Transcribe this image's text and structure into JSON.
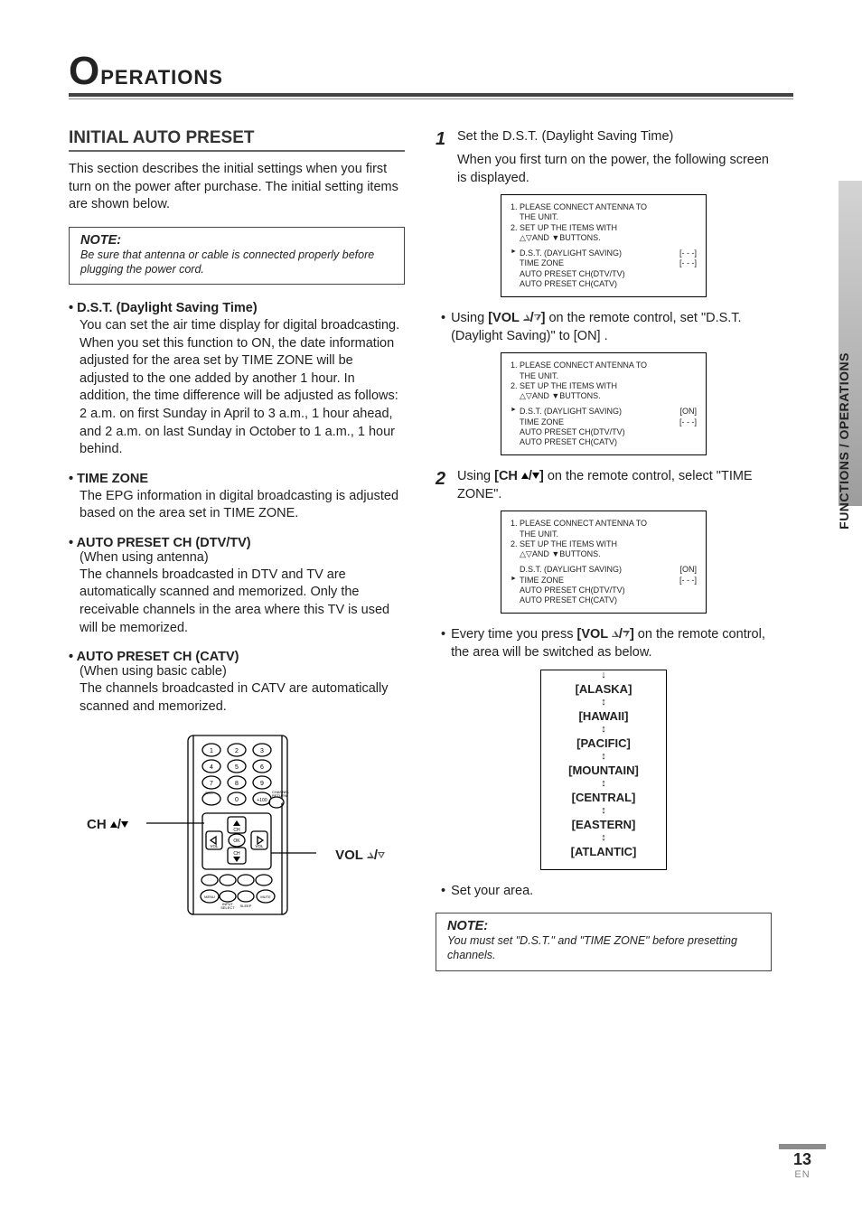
{
  "chapter": {
    "big_letter": "O",
    "rest": "PERATIONS"
  },
  "side_label": "FUNCTIONS / OPERATIONS",
  "page_number": "13",
  "page_lang": "EN",
  "left": {
    "section_title": "INITIAL AUTO PRESET",
    "intro": "This section describes the initial settings when you first turn on the power after purchase. The initial setting items are shown below.",
    "note1_title": "NOTE:",
    "note1_body": "Be sure that antenna or cable is connected properly before plugging the power cord.",
    "dst_head": "• D.S.T. (Daylight Saving Time)",
    "dst_body": "You can set the air time display for digital broadcasting. When you set this function to ON, the date information adjusted for the area set by TIME ZONE will be adjusted to the one added by another 1 hour. In addition, the time difference will be adjusted as follows: 2 a.m. on first Sunday in April to 3 a.m., 1 hour ahead, and 2 a.m. on last Sunday in October to 1 a.m., 1 hour behind.",
    "tz_head": "• TIME ZONE",
    "tz_body": "The EPG information in digital broadcasting is adjusted based on the area set in TIME ZONE.",
    "ap1_head": "• AUTO PRESET CH (DTV/TV)",
    "ap1_sub": "(When using antenna)",
    "ap1_body": "The channels broadcasted in DTV and TV are automatically scanned and memorized. Only the receivable channels in the area where this TV is used will be memorized.",
    "ap2_head": "• AUTO PRESET CH (CATV)",
    "ap2_sub": "(When using basic cable)",
    "ap2_body": "The channels broadcasted in CATV are automatically scanned and memorized.",
    "remote_left_label": "CH ▲/▼",
    "remote_right_label": "VOL △/▽"
  },
  "right": {
    "step1_num": "1",
    "step1_line1": "Set the D.S.T. (Daylight Saving Time)",
    "step1_line2": "When you first turn on the power, the following screen is displayed.",
    "osd_common": {
      "l1": "1. PLEASE CONNECT ANTENNA TO",
      "l1b": "THE UNIT.",
      "l2": "2. SET UP THE ITEMS WITH",
      "l2b": "△▽AND ▼BUTTONS.",
      "r1": "D.S.T. (Daylight Saving)",
      "r2": "TIME ZONE",
      "r3": "AUTO PRESET CH(DTV/TV)",
      "r4": "AUTO PRESET CH(CATV)"
    },
    "osd1": {
      "v1": "[- - -]",
      "v2": "[- - -]"
    },
    "vol_sub_prefix": "Using ",
    "vol_btn": "[VOL △/▽]",
    "vol_sub_suffix": " on the remote control, set \"D.S.T. (Daylight Saving)\" to [ON] .",
    "osd2": {
      "v1": "[ON]",
      "v2": "[- - -]"
    },
    "step2_num": "2",
    "step2_prefix": "Using ",
    "step2_btn": "[CH ▲/▼]",
    "step2_suffix": " on the remote control, select \"TIME ZONE\".",
    "osd3": {
      "v1": "[ON]",
      "v2": "[- - -]"
    },
    "vol_every_prefix": "Every time you press ",
    "vol_every_btn": "[VOL △/▽]",
    "vol_every_suffix": " on the remote control, the area will be switched as below.",
    "timezones": [
      "[ALASKA]",
      "[HAWAII]",
      "[PACIFIC]",
      "[MOUNTAIN]",
      "[CENTRAL]",
      "[EASTERN]",
      "[ATLANTIC]"
    ],
    "set_area": "Set your area.",
    "note2_title": "NOTE:",
    "note2_body": "You must set \"D.S.T.\" and \"TIME ZONE\" before presetting channels."
  }
}
